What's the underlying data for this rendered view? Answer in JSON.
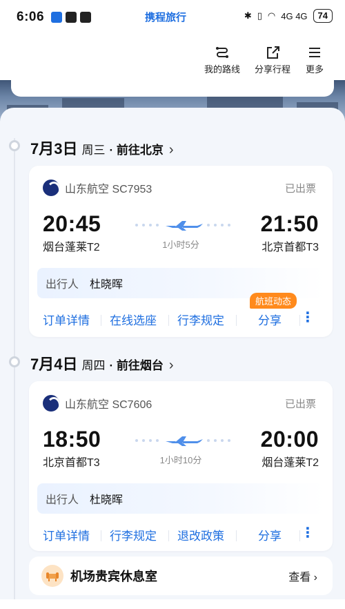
{
  "status_bar": {
    "time": "6:06",
    "brand": "携程旅行",
    "network": "4G 4G",
    "battery": "74"
  },
  "toolbar": {
    "route_label": "我的路线",
    "share_label": "分享行程",
    "more_label": "更多"
  },
  "days": [
    {
      "date": "7月3日",
      "weekday": "周三",
      "destination": "· 前往北京",
      "flight": {
        "airline": "山东航空 SC7953",
        "status": "已出票",
        "dep_time": "20:45",
        "dep_airport": "烟台蓬莱T2",
        "arr_time": "21:50",
        "arr_airport": "北京首都T3",
        "duration": "1小时5分",
        "passenger_label": "出行人",
        "passenger_name": "杜晓晖",
        "actions": [
          "订单详情",
          "在线选座",
          "行李规定",
          "分享"
        ],
        "badge": "航班动态"
      }
    },
    {
      "date": "7月4日",
      "weekday": "周四",
      "destination": "· 前往烟台",
      "flight": {
        "airline": "山东航空 SC7606",
        "status": "已出票",
        "dep_time": "18:50",
        "dep_airport": "北京首都T3",
        "arr_time": "20:00",
        "arr_airport": "烟台蓬莱T2",
        "duration": "1小时10分",
        "passenger_label": "出行人",
        "passenger_name": "杜晓晖",
        "actions": [
          "订单详情",
          "行李规定",
          "退改政策",
          "分享"
        ]
      }
    }
  ],
  "lounge": {
    "title": "机场贵宾休息室",
    "link": "查看"
  },
  "colors": {
    "accent": "#1f6fe0",
    "badge": "#ff8a1c"
  }
}
